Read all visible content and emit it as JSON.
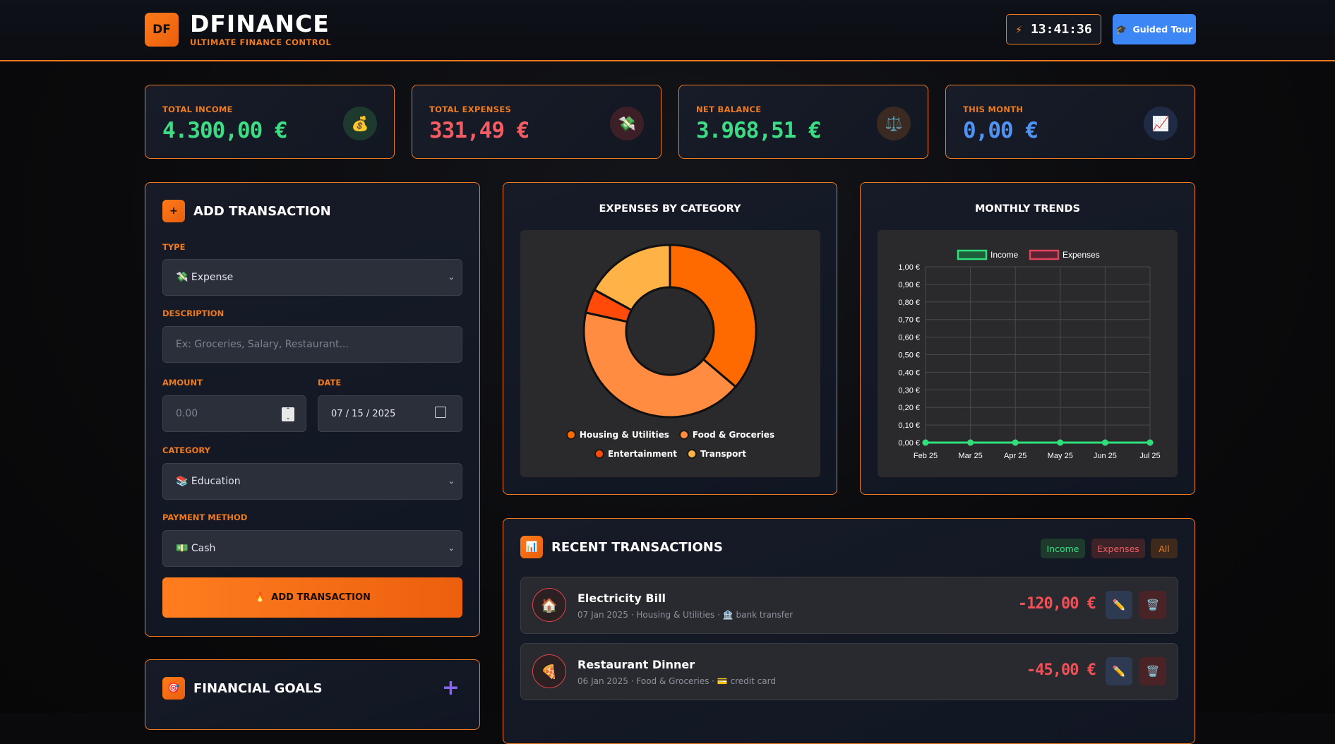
{
  "header": {
    "logo": "DF",
    "title": "DFINANCE",
    "subtitle": "ULTIMATE FINANCE CONTROL",
    "clock": "13:41:36",
    "tour_label": "Guided Tour"
  },
  "stats": [
    {
      "label": "TOTAL INCOME",
      "value": "4.300,00 €",
      "color": "#3ddc84",
      "icon": "money-bag-icon",
      "glyph": "💰",
      "icon_bg": "#1e3a2e"
    },
    {
      "label": "TOTAL EXPENSES",
      "value": "331,49 €",
      "color": "#f25c62",
      "icon": "money-wings-icon",
      "glyph": "💸",
      "icon_bg": "#3d2027"
    },
    {
      "label": "NET BALANCE",
      "value": "3.968,51 €",
      "color": "#3ddc84",
      "icon": "balance-scale-icon",
      "glyph": "⚖️",
      "icon_bg": "#3b2a22"
    },
    {
      "label": "THIS MONTH",
      "value": "0,00 €",
      "color": "#4f94f5",
      "icon": "chart-up-icon",
      "glyph": "📈",
      "icon_bg": "#1f2b45"
    }
  ],
  "add_transaction": {
    "title": "ADD TRANSACTION",
    "type_label": "TYPE",
    "type_value": "💸  Expense",
    "description_label": "DESCRIPTION",
    "description_placeholder": "Ex: Groceries, Salary, Restaurant...",
    "amount_label": "AMOUNT",
    "amount_placeholder": "0.00",
    "date_label": "DATE",
    "date_value": "07 / 15 / 2025",
    "category_label": "CATEGORY",
    "category_value": "📚  Education",
    "payment_label": "PAYMENT METHOD",
    "payment_value": "💵  Cash",
    "button_label": "ADD TRANSACTION"
  },
  "goals": {
    "title": "FINANCIAL GOALS",
    "add_glyph": "+"
  },
  "expenses_chart": {
    "title": "EXPENSES BY CATEGORY",
    "legend": [
      {
        "label": "Housing & Utilities",
        "color": "#ff6a00"
      },
      {
        "label": "Food & Groceries",
        "color": "#ff8c40"
      },
      {
        "label": "Entertainment",
        "color": "#ff4a0a"
      },
      {
        "label": "Transport",
        "color": "#ffb347"
      }
    ]
  },
  "trends_chart": {
    "title": "MONTHLY TRENDS",
    "legend_income": "Income",
    "legend_expenses": "Expenses",
    "y_ticks": [
      "1,00 €",
      "0,90 €",
      "0,80 €",
      "0,70 €",
      "0,60 €",
      "0,50 €",
      "0,40 €",
      "0,30 €",
      "0,20 €",
      "0,10 €",
      "0,00 €"
    ],
    "x_ticks": [
      "Feb 25",
      "Mar 25",
      "Apr 25",
      "May 25",
      "Jun 25",
      "Jul 25"
    ]
  },
  "chart_data": [
    {
      "type": "pie",
      "title": "EXPENSES BY CATEGORY",
      "categories": [
        "Housing & Utilities",
        "Food & Groceries",
        "Entertainment",
        "Transport"
      ],
      "values": [
        120,
        140,
        15,
        56.49
      ],
      "colors": [
        "#ff6a00",
        "#ff8c40",
        "#ff4a0a",
        "#ffb347"
      ],
      "donut": true,
      "legend_position": "bottom"
    },
    {
      "type": "line",
      "title": "MONTHLY TRENDS",
      "x": [
        "Feb 25",
        "Mar 25",
        "Apr 25",
        "May 25",
        "Jun 25",
        "Jul 25"
      ],
      "series": [
        {
          "name": "Income",
          "values": [
            0,
            0,
            0,
            0,
            0,
            0
          ],
          "color": "#2ee07a"
        },
        {
          "name": "Expenses",
          "values": [
            0,
            0,
            0,
            0,
            0,
            0
          ],
          "color": "#e0445a"
        }
      ],
      "ylim": [
        0,
        1
      ],
      "grid": true,
      "legend_position": "top"
    }
  ],
  "recent": {
    "title": "RECENT TRANSACTIONS",
    "filter_income": "Income",
    "filter_expenses": "Expenses",
    "filter_all": "All",
    "rows": [
      {
        "glyph": "🏠",
        "icon": "house-icon",
        "name": "Electricity Bill",
        "meta": "07 Jan 2025  ·  Housing & Utilities  ·  🏦 bank transfer",
        "amount": "-120,00 €"
      },
      {
        "glyph": "🍕",
        "icon": "pizza-icon",
        "name": "Restaurant Dinner",
        "meta": "06 Jan 2025  ·  Food & Groceries  ·  💳 credit card",
        "amount": "-45,00 €"
      }
    ]
  }
}
